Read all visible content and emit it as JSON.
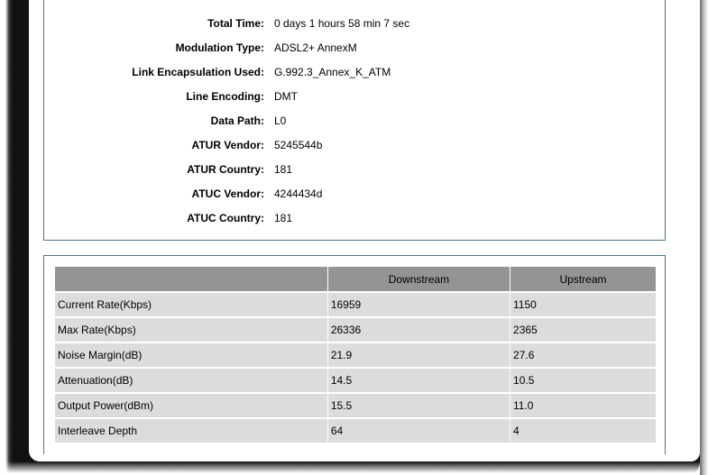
{
  "status": [
    {
      "label": "Total Time:",
      "value": "0 days 1 hours 58 min 7 sec"
    },
    {
      "label": "Modulation Type:",
      "value": "ADSL2+ AnnexM"
    },
    {
      "label": "Link Encapsulation Used:",
      "value": "G.992.3_Annex_K_ATM"
    },
    {
      "label": "Line Encoding:",
      "value": "DMT"
    },
    {
      "label": "Data Path:",
      "value": "L0"
    },
    {
      "label": "ATUR Vendor:",
      "value": "5245544b"
    },
    {
      "label": "ATUR Country:",
      "value": "181"
    },
    {
      "label": "ATUC Vendor:",
      "value": "4244434d"
    },
    {
      "label": "ATUC Country:",
      "value": "181"
    }
  ],
  "stats_table": {
    "headers": [
      "",
      "Downstream",
      "Upstream"
    ],
    "rows": [
      {
        "name": "Current Rate(Kbps)",
        "downstream": "16959",
        "upstream": "1150"
      },
      {
        "name": "Max Rate(Kbps)",
        "downstream": "26336",
        "upstream": "2365"
      },
      {
        "name": "Noise Margin(dB)",
        "downstream": "21.9",
        "upstream": "27.6"
      },
      {
        "name": "Attenuation(dB)",
        "downstream": "14.5",
        "upstream": "10.5"
      },
      {
        "name": "Output Power(dBm)",
        "downstream": "15.5",
        "upstream": "11.0"
      },
      {
        "name": "Interleave Depth",
        "downstream": "64",
        "upstream": "4"
      }
    ]
  }
}
